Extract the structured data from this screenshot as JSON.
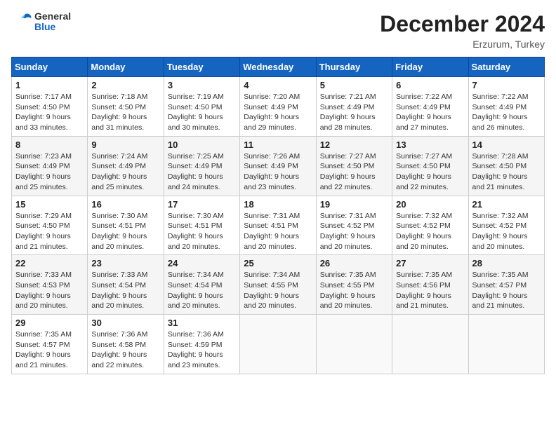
{
  "header": {
    "logo_line1": "General",
    "logo_line2": "Blue",
    "month_year": "December 2024",
    "location": "Erzurum, Turkey"
  },
  "weekdays": [
    "Sunday",
    "Monday",
    "Tuesday",
    "Wednesday",
    "Thursday",
    "Friday",
    "Saturday"
  ],
  "weeks": [
    [
      {
        "day": "1",
        "info": "Sunrise: 7:17 AM\nSunset: 4:50 PM\nDaylight: 9 hours\nand 33 minutes."
      },
      {
        "day": "2",
        "info": "Sunrise: 7:18 AM\nSunset: 4:50 PM\nDaylight: 9 hours\nand 31 minutes."
      },
      {
        "day": "3",
        "info": "Sunrise: 7:19 AM\nSunset: 4:50 PM\nDaylight: 9 hours\nand 30 minutes."
      },
      {
        "day": "4",
        "info": "Sunrise: 7:20 AM\nSunset: 4:49 PM\nDaylight: 9 hours\nand 29 minutes."
      },
      {
        "day": "5",
        "info": "Sunrise: 7:21 AM\nSunset: 4:49 PM\nDaylight: 9 hours\nand 28 minutes."
      },
      {
        "day": "6",
        "info": "Sunrise: 7:22 AM\nSunset: 4:49 PM\nDaylight: 9 hours\nand 27 minutes."
      },
      {
        "day": "7",
        "info": "Sunrise: 7:22 AM\nSunset: 4:49 PM\nDaylight: 9 hours\nand 26 minutes."
      }
    ],
    [
      {
        "day": "8",
        "info": "Sunrise: 7:23 AM\nSunset: 4:49 PM\nDaylight: 9 hours\nand 25 minutes."
      },
      {
        "day": "9",
        "info": "Sunrise: 7:24 AM\nSunset: 4:49 PM\nDaylight: 9 hours\nand 25 minutes."
      },
      {
        "day": "10",
        "info": "Sunrise: 7:25 AM\nSunset: 4:49 PM\nDaylight: 9 hours\nand 24 minutes."
      },
      {
        "day": "11",
        "info": "Sunrise: 7:26 AM\nSunset: 4:49 PM\nDaylight: 9 hours\nand 23 minutes."
      },
      {
        "day": "12",
        "info": "Sunrise: 7:27 AM\nSunset: 4:50 PM\nDaylight: 9 hours\nand 22 minutes."
      },
      {
        "day": "13",
        "info": "Sunrise: 7:27 AM\nSunset: 4:50 PM\nDaylight: 9 hours\nand 22 minutes."
      },
      {
        "day": "14",
        "info": "Sunrise: 7:28 AM\nSunset: 4:50 PM\nDaylight: 9 hours\nand 21 minutes."
      }
    ],
    [
      {
        "day": "15",
        "info": "Sunrise: 7:29 AM\nSunset: 4:50 PM\nDaylight: 9 hours\nand 21 minutes."
      },
      {
        "day": "16",
        "info": "Sunrise: 7:30 AM\nSunset: 4:51 PM\nDaylight: 9 hours\nand 20 minutes."
      },
      {
        "day": "17",
        "info": "Sunrise: 7:30 AM\nSunset: 4:51 PM\nDaylight: 9 hours\nand 20 minutes."
      },
      {
        "day": "18",
        "info": "Sunrise: 7:31 AM\nSunset: 4:51 PM\nDaylight: 9 hours\nand 20 minutes."
      },
      {
        "day": "19",
        "info": "Sunrise: 7:31 AM\nSunset: 4:52 PM\nDaylight: 9 hours\nand 20 minutes."
      },
      {
        "day": "20",
        "info": "Sunrise: 7:32 AM\nSunset: 4:52 PM\nDaylight: 9 hours\nand 20 minutes."
      },
      {
        "day": "21",
        "info": "Sunrise: 7:32 AM\nSunset: 4:52 PM\nDaylight: 9 hours\nand 20 minutes."
      }
    ],
    [
      {
        "day": "22",
        "info": "Sunrise: 7:33 AM\nSunset: 4:53 PM\nDaylight: 9 hours\nand 20 minutes."
      },
      {
        "day": "23",
        "info": "Sunrise: 7:33 AM\nSunset: 4:54 PM\nDaylight: 9 hours\nand 20 minutes."
      },
      {
        "day": "24",
        "info": "Sunrise: 7:34 AM\nSunset: 4:54 PM\nDaylight: 9 hours\nand 20 minutes."
      },
      {
        "day": "25",
        "info": "Sunrise: 7:34 AM\nSunset: 4:55 PM\nDaylight: 9 hours\nand 20 minutes."
      },
      {
        "day": "26",
        "info": "Sunrise: 7:35 AM\nSunset: 4:55 PM\nDaylight: 9 hours\nand 20 minutes."
      },
      {
        "day": "27",
        "info": "Sunrise: 7:35 AM\nSunset: 4:56 PM\nDaylight: 9 hours\nand 21 minutes."
      },
      {
        "day": "28",
        "info": "Sunrise: 7:35 AM\nSunset: 4:57 PM\nDaylight: 9 hours\nand 21 minutes."
      }
    ],
    [
      {
        "day": "29",
        "info": "Sunrise: 7:35 AM\nSunset: 4:57 PM\nDaylight: 9 hours\nand 21 minutes."
      },
      {
        "day": "30",
        "info": "Sunrise: 7:36 AM\nSunset: 4:58 PM\nDaylight: 9 hours\nand 22 minutes."
      },
      {
        "day": "31",
        "info": "Sunrise: 7:36 AM\nSunset: 4:59 PM\nDaylight: 9 hours\nand 23 minutes."
      },
      {
        "day": "",
        "info": ""
      },
      {
        "day": "",
        "info": ""
      },
      {
        "day": "",
        "info": ""
      },
      {
        "day": "",
        "info": ""
      }
    ]
  ]
}
